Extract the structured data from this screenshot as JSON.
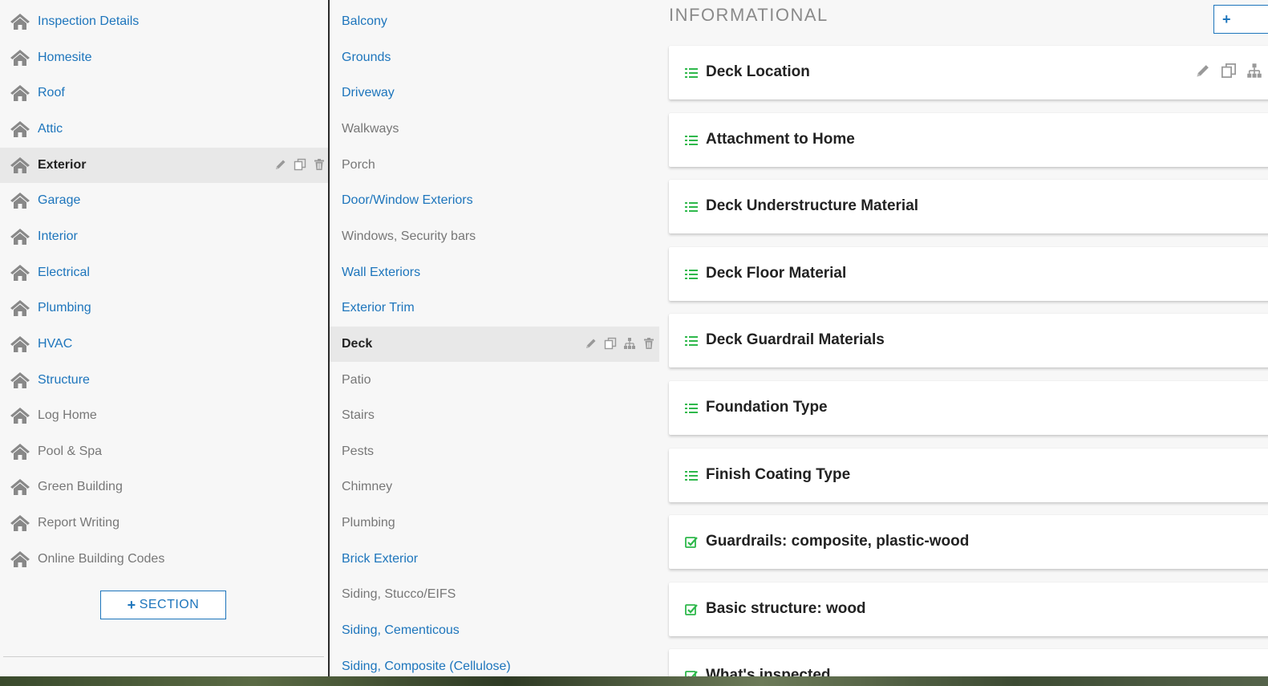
{
  "sections": {
    "items": [
      {
        "label": "Inspection Details",
        "style": "link"
      },
      {
        "label": "Homesite",
        "style": "link"
      },
      {
        "label": "Roof",
        "style": "link"
      },
      {
        "label": "Attic",
        "style": "link"
      },
      {
        "label": "Exterior",
        "style": "active"
      },
      {
        "label": "Garage",
        "style": "link"
      },
      {
        "label": "Interior",
        "style": "link"
      },
      {
        "label": "Electrical",
        "style": "link"
      },
      {
        "label": "Plumbing",
        "style": "link"
      },
      {
        "label": "HVAC",
        "style": "link"
      },
      {
        "label": "Structure",
        "style": "link"
      },
      {
        "label": "Log Home",
        "style": "muted"
      },
      {
        "label": "Pool & Spa",
        "style": "muted"
      },
      {
        "label": "Green Building",
        "style": "muted"
      },
      {
        "label": "Report Writing",
        "style": "muted"
      },
      {
        "label": "Online Building Codes",
        "style": "muted"
      }
    ],
    "add_button": {
      "icon": "+",
      "label": "SECTION"
    }
  },
  "subsections": {
    "items": [
      {
        "label": "Balcony",
        "style": "link"
      },
      {
        "label": "Grounds",
        "style": "link"
      },
      {
        "label": "Driveway",
        "style": "link"
      },
      {
        "label": "Walkways",
        "style": "muted"
      },
      {
        "label": "Porch",
        "style": "muted"
      },
      {
        "label": "Door/Window Exteriors",
        "style": "link"
      },
      {
        "label": "Windows, Security bars",
        "style": "muted"
      },
      {
        "label": "Wall Exteriors",
        "style": "link"
      },
      {
        "label": "Exterior Trim",
        "style": "link"
      },
      {
        "label": "Deck",
        "style": "active"
      },
      {
        "label": "Patio",
        "style": "muted"
      },
      {
        "label": "Stairs",
        "style": "muted"
      },
      {
        "label": "Pests",
        "style": "muted"
      },
      {
        "label": "Chimney",
        "style": "muted"
      },
      {
        "label": "Plumbing",
        "style": "muted"
      },
      {
        "label": "Brick Exterior",
        "style": "link"
      },
      {
        "label": "Siding, Stucco/EIFS",
        "style": "muted"
      },
      {
        "label": "Siding, Cementicous",
        "style": "link"
      },
      {
        "label": "Siding, Composite (Cellulose)",
        "style": "link"
      }
    ]
  },
  "content": {
    "heading": "INFORMATIONAL",
    "new_button_icon": "+",
    "cards": [
      {
        "title": "Deck Location",
        "icon": "list-icon"
      },
      {
        "title": "Attachment to Home",
        "icon": "list-icon"
      },
      {
        "title": "Deck Understructure Material",
        "icon": "list-icon"
      },
      {
        "title": "Deck Floor Material",
        "icon": "list-icon"
      },
      {
        "title": "Deck Guardrail Materials",
        "icon": "list-icon"
      },
      {
        "title": "Foundation Type",
        "icon": "list-icon"
      },
      {
        "title": "Finish Coating Type",
        "icon": "list-icon"
      },
      {
        "title": "Guardrails: composite, plastic-wood",
        "icon": "check-square-icon"
      },
      {
        "title": "Basic structure: wood",
        "icon": "check-square-icon"
      },
      {
        "title": "What's inspected",
        "icon": "check-square-icon"
      }
    ]
  },
  "colors": {
    "link": "#1d75bc",
    "muted": "#777777",
    "active_bg": "#e8e8e8",
    "icon_green": "#2eb84b",
    "house_icon": "#888888"
  }
}
